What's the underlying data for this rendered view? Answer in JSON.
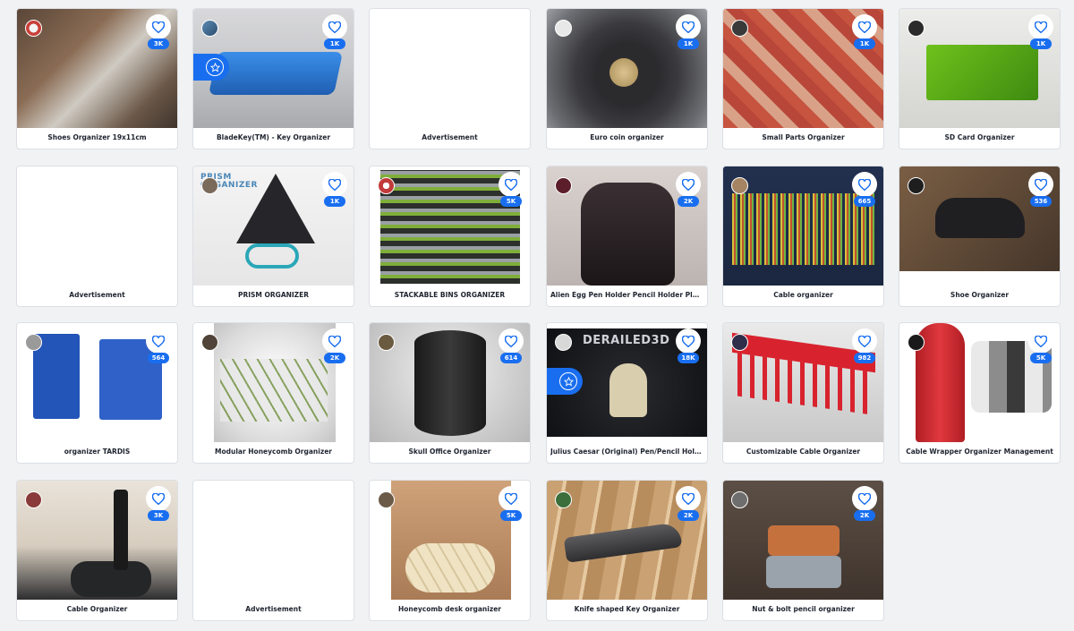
{
  "colors": {
    "accent": "#196ef0",
    "background": "#f1f2f4",
    "card": "#ffffff"
  },
  "cards": [
    {
      "title": "Shoes Organizer 19x11cm",
      "likes": "3K",
      "avatar_icon": "user-avatar",
      "heart_icon": "heart-outline-icon"
    },
    {
      "title": "BladeKey(TM) - Key Organizer",
      "likes": "1K",
      "avatar_icon": "user-avatar",
      "featured_icon": "star-icon"
    },
    {
      "title": "Advertisement"
    },
    {
      "title": "Euro coin organizer",
      "likes": "1K"
    },
    {
      "title": "Small Parts Organizer",
      "likes": "1K"
    },
    {
      "title": "SD Card Organizer",
      "likes": "1K"
    },
    {
      "title": "Advertisement"
    },
    {
      "title": "PRISM ORGANIZER",
      "likes": "1K",
      "overlay": "PRISM\nORGANIZER"
    },
    {
      "title": "STACKABLE BINS ORGANIZER",
      "likes": "5K"
    },
    {
      "title": "Alien Egg Pen Holder Pencil Holder Plant Pot D...",
      "likes": "2K"
    },
    {
      "title": "Cable organizer",
      "likes": "665"
    },
    {
      "title": "Shoe Organizer",
      "likes": "536"
    },
    {
      "title": "organizer TARDIS",
      "likes": "564"
    },
    {
      "title": "Modular Honeycomb Organizer",
      "likes": "2K"
    },
    {
      "title": "Skull Office Organizer",
      "likes": "614"
    },
    {
      "title": "Julius Caesar (Original) Pen/Pencil Holder",
      "likes": "18K",
      "overlay": "DERAILED3D",
      "featured_icon": "star-icon"
    },
    {
      "title": "Customizable Cable Organizer",
      "likes": "982"
    },
    {
      "title": "Cable Wrapper Organizer Management",
      "likes": "5K"
    },
    {
      "title": "Cable Organizer",
      "likes": "3K"
    },
    {
      "title": "Advertisement"
    },
    {
      "title": "Honeycomb desk organizer",
      "likes": "5K"
    },
    {
      "title": "Knife shaped Key Organizer",
      "likes": "2K"
    },
    {
      "title": "Nut & bolt pencil organizer",
      "likes": "2K"
    }
  ]
}
